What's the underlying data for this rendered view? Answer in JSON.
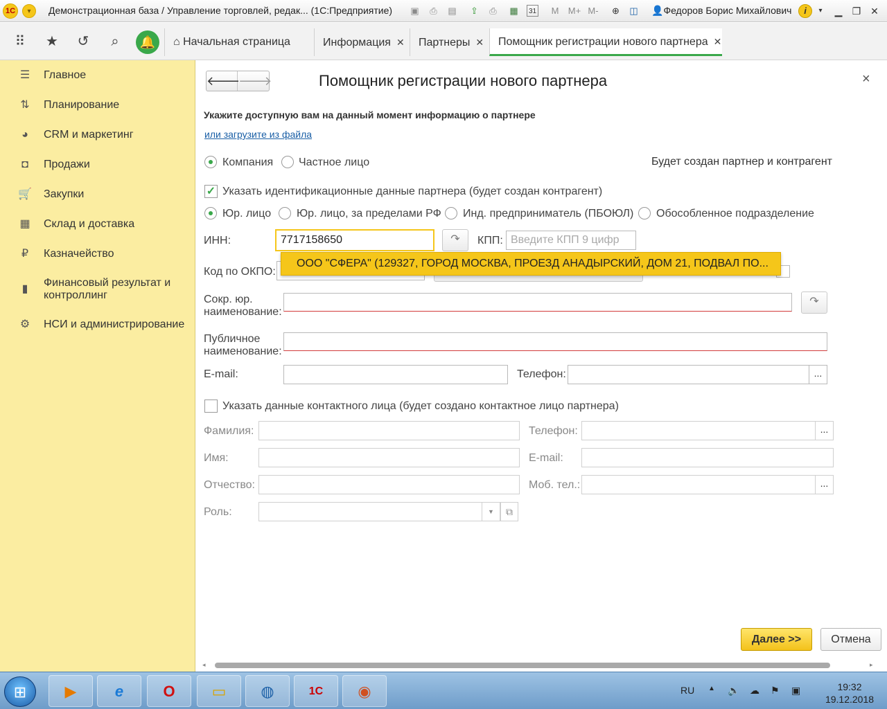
{
  "window": {
    "title": "Демонстрационная база / Управление торговлей, редак...  (1С:Предприятие)",
    "user": "Федоров Борис Михайлович",
    "tb_labels": {
      "m": "M",
      "mplus": "M+",
      "mminus": "M-",
      "cal": "31"
    }
  },
  "tabs": [
    {
      "label": "Начальная страница"
    },
    {
      "label": "Информация"
    },
    {
      "label": "Партнеры"
    },
    {
      "label": "Помощник регистрации нового партнера"
    }
  ],
  "sidebar": {
    "items": [
      {
        "label": "Главное",
        "icon": "menu-icon"
      },
      {
        "label": "Планирование",
        "icon": "planning-icon"
      },
      {
        "label": "CRM и маркетинг",
        "icon": "pie-icon"
      },
      {
        "label": "Продажи",
        "icon": "bag-icon"
      },
      {
        "label": "Закупки",
        "icon": "cart-icon"
      },
      {
        "label": "Склад и доставка",
        "icon": "warehouse-icon"
      },
      {
        "label": "Казначейство",
        "icon": "ruble-icon"
      },
      {
        "label": "Финансовый результат и контроллинг",
        "icon": "bar-chart-icon"
      },
      {
        "label": "НСИ и администрирование",
        "icon": "gear-icon"
      }
    ]
  },
  "form": {
    "title": "Помощник регистрации нового партнера",
    "hint": "Укажите доступную вам на данный момент информацию о партнере",
    "load_link": "или загрузите из файла",
    "type_company": "Компания",
    "type_person": "Частное лицо",
    "info_right": "Будет создан партнер и контрагент",
    "check_ident": "Указать идентификационные данные партнера (будет создан контрагент)",
    "legal_types": [
      "Юр. лицо",
      "Юр. лицо, за пределами РФ",
      "Инд. предприниматель (ПБОЮЛ)",
      "Обособленное подразделение"
    ],
    "inn_label": "ИНН:",
    "inn_value": "7717158650",
    "kpp_label": "КПП:",
    "kpp_placeholder": "Введите КПП 9 цифр",
    "suggestion": "ООО \"СФЕРА\" (129327, ГОРОД МОСКВА, ПРОЕЗД АНАДЫРСКИЙ, ДОМ 21, ПОДВАЛ ПО...",
    "okpo_label": "Код по ОКПО:",
    "short_name_label": "Сокр. юр. наименование:",
    "public_name_label": "Публичное наименование:",
    "email_label": "E-mail:",
    "phone_label": "Телефон:",
    "more": "...",
    "check_contact": "Указать данные контактного лица (будет создано контактное лицо партнера)",
    "contact": {
      "surname": "Фамилия:",
      "name": "Имя:",
      "patronymic": "Отчество:",
      "role": "Роль:",
      "phone": "Телефон:",
      "email": "E-mail:",
      "mobile": "Моб. тел.:"
    },
    "next": "Далее >>",
    "cancel": "Отмена"
  },
  "taskbar": {
    "lang": "RU",
    "time": "19:32",
    "date": "19.12.2018",
    "apps": [
      "media-player-icon",
      "internet-explorer-icon",
      "opera-icon",
      "explorer-icon",
      "app-icon",
      "1c-icon",
      "camera-icon"
    ]
  },
  "colors": {
    "accent": "#f5c61a",
    "sidebar": "#fbeda1",
    "green": "#3aa84a"
  }
}
